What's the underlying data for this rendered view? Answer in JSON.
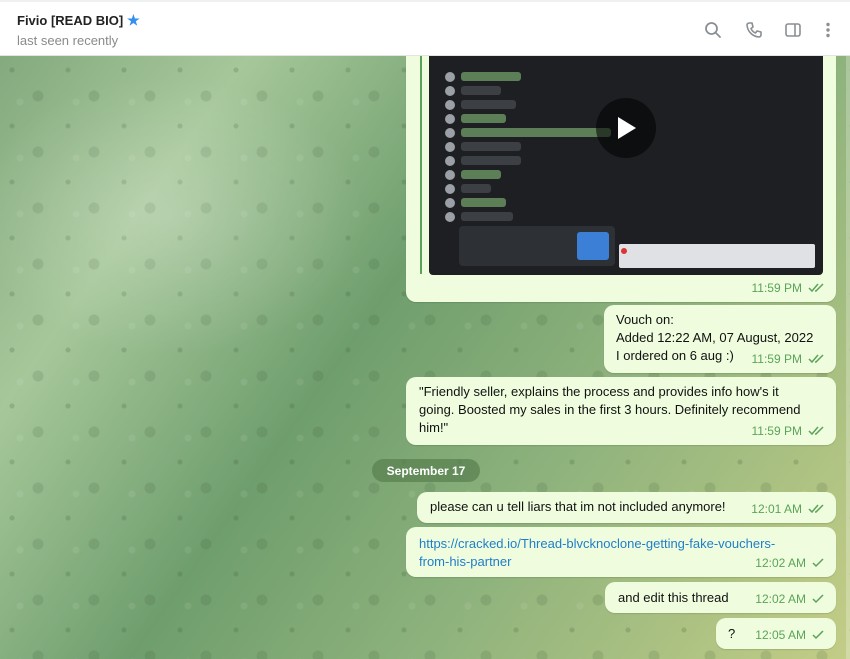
{
  "header": {
    "title": "Fivio [READ BIO]",
    "status": "last seen recently",
    "icons": [
      "search-icon",
      "phone-icon",
      "sidebar-toggle-icon",
      "more-vertical-icon"
    ]
  },
  "colors": {
    "bubble_out": "#effdde",
    "time_green": "#5ba35a",
    "link": "#1f7ec9",
    "accent": "#3390ec"
  },
  "messages": [
    {
      "kind": "video",
      "time": "11:59 PM",
      "status": "read"
    },
    {
      "kind": "text",
      "lines": [
        "Vouch on:",
        "Added 12:22 AM, 07 August, 2022",
        "I ordered on 6 aug :)"
      ],
      "time": "11:59 PM",
      "status": "read"
    },
    {
      "kind": "text",
      "lines": [
        "\"Friendly seller, explains the process and provides info how's it",
        "going. Boosted my sales in the first 3 hours. Definitely recommend",
        "him!\""
      ],
      "time": "11:59 PM",
      "status": "read"
    },
    {
      "kind": "date",
      "label": "September 17"
    },
    {
      "kind": "text",
      "lines": [
        "please can u tell liars that im not included anymore!"
      ],
      "time": "12:01 AM",
      "status": "read"
    },
    {
      "kind": "link",
      "lines": [
        "https://cracked.io/Thread-blvcknoclone-getting-fake-vouchers-",
        "from-his-partner"
      ],
      "time": "12:02 AM",
      "status": "sent"
    },
    {
      "kind": "text",
      "lines": [
        "and edit this thread"
      ],
      "time": "12:02 AM",
      "status": "sent"
    },
    {
      "kind": "text",
      "lines": [
        "?"
      ],
      "time": "12:05 AM",
      "status": "sent"
    }
  ]
}
